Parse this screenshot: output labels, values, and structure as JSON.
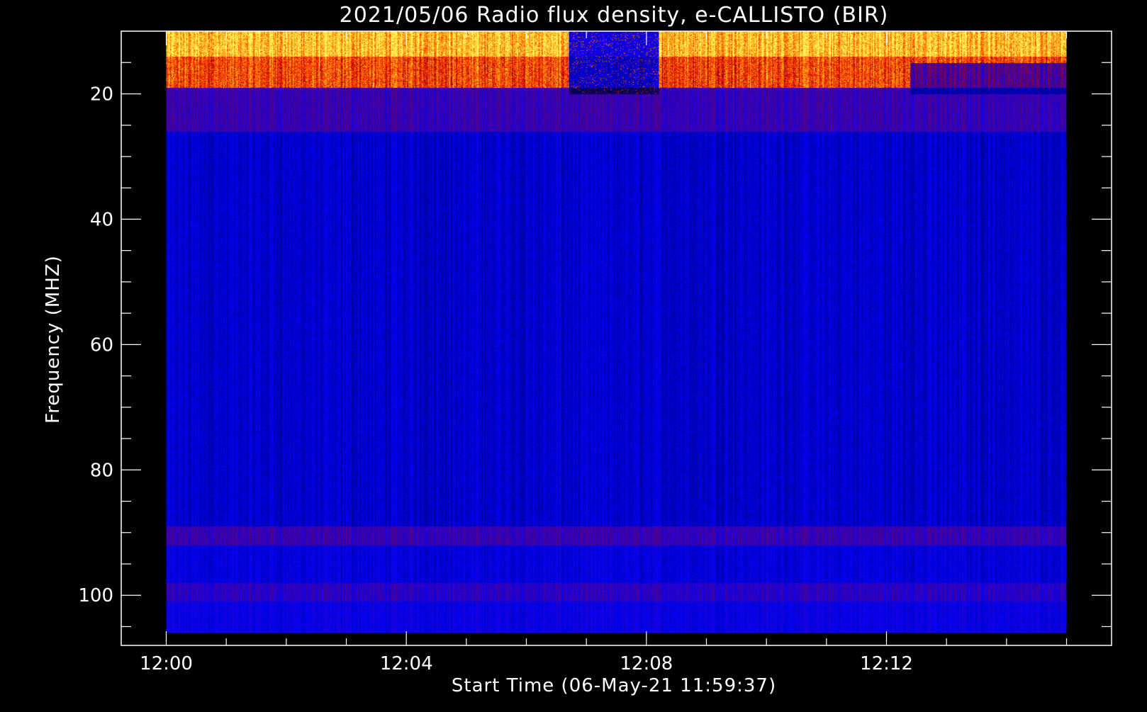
{
  "chart_data": {
    "type": "heatmap",
    "title": "2021/05/06  Radio flux density, e-CALLISTO (BIR)",
    "xlabel": "Start Time (06-May-21 11:59:37)",
    "ylabel": "Frequency (MHZ)",
    "x_tick_labels": [
      "12:00",
      "12:04",
      "12:08",
      "12:12"
    ],
    "x_tick_values_min": [
      0,
      4,
      8,
      12
    ],
    "x_minor_step_min": 1,
    "xlim_min": [
      -0.75,
      15.75
    ],
    "data_xlim_min": [
      0,
      15
    ],
    "y_tick_labels": [
      "20",
      "40",
      "60",
      "80",
      "100"
    ],
    "y_tick_values": [
      20,
      40,
      60,
      80,
      100
    ],
    "y_minor_step": 5,
    "ylim": [
      10,
      108
    ],
    "data_ylim": [
      10,
      106
    ],
    "y_reversed": true,
    "grid": false,
    "colormap": [
      "#000000",
      "#0000ff",
      "#b00000",
      "#ff2a00",
      "#ff9900",
      "#ffff66"
    ],
    "frame_color": "#ffffff",
    "background": "#000000",
    "intensity_bands": [
      {
        "freq_from": 10,
        "freq_to": 14,
        "level": 0.9,
        "description": "strong emission"
      },
      {
        "freq_from": 14,
        "freq_to": 19,
        "level": 0.68
      },
      {
        "freq_from": 19,
        "freq_to": 26,
        "level": 0.3
      },
      {
        "freq_from": 26,
        "freq_to": 89,
        "level": 0.18
      },
      {
        "freq_from": 89,
        "freq_to": 92,
        "level": 0.3
      },
      {
        "freq_from": 92,
        "freq_to": 98,
        "level": 0.2
      },
      {
        "freq_from": 98,
        "freq_to": 101,
        "level": 0.28
      },
      {
        "freq_from": 101,
        "freq_to": 106,
        "level": 0.22
      }
    ],
    "dark_time_window_min": [
      6.7,
      8.2
    ]
  }
}
